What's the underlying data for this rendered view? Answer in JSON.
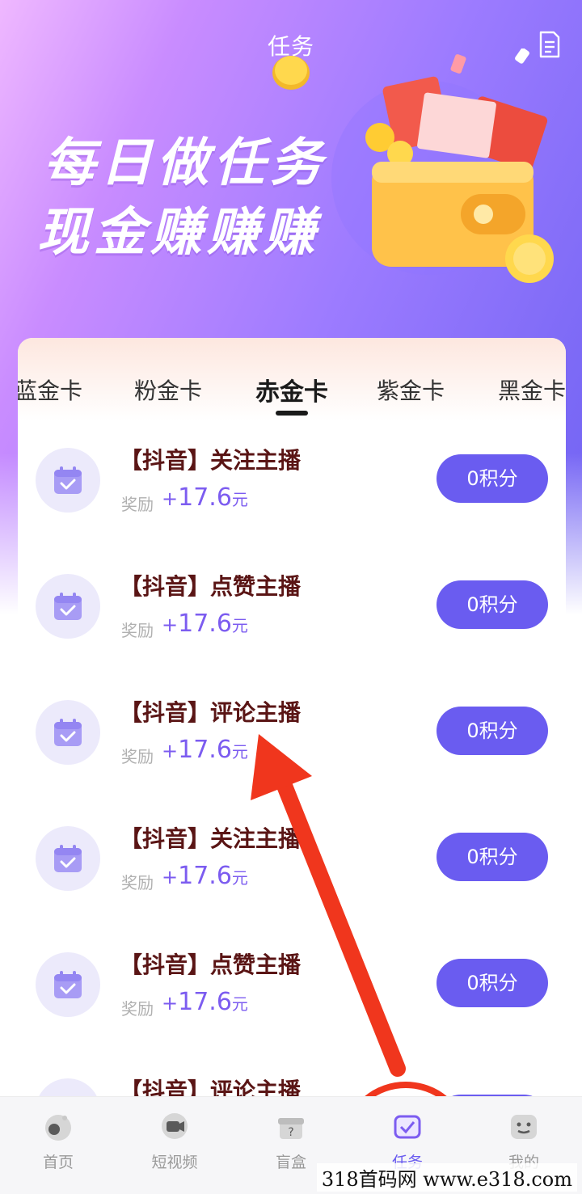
{
  "header": {
    "title": "任务",
    "banner_line1": "每日做任务",
    "banner_line2": "现金赚赚赚"
  },
  "tabs": [
    {
      "label": "蓝金卡",
      "active": false
    },
    {
      "label": "粉金卡",
      "active": false
    },
    {
      "label": "赤金卡",
      "active": true
    },
    {
      "label": "紫金卡",
      "active": false
    },
    {
      "label": "黑金卡",
      "active": false
    }
  ],
  "tasks": [
    {
      "title": "【抖音】关注主播",
      "reward_label": "奖励",
      "reward_plus": "+",
      "reward_value": "17.6",
      "reward_unit": "元",
      "button": "0积分"
    },
    {
      "title": "【抖音】点赞主播",
      "reward_label": "奖励",
      "reward_plus": "+",
      "reward_value": "17.6",
      "reward_unit": "元",
      "button": "0积分"
    },
    {
      "title": "【抖音】评论主播",
      "reward_label": "奖励",
      "reward_plus": "+",
      "reward_value": "17.6",
      "reward_unit": "元",
      "button": "0积分"
    },
    {
      "title": "【抖音】关注主播",
      "reward_label": "奖励",
      "reward_plus": "+",
      "reward_value": "17.6",
      "reward_unit": "元",
      "button": "0积分"
    },
    {
      "title": "【抖音】点赞主播",
      "reward_label": "奖励",
      "reward_plus": "+",
      "reward_value": "17.6",
      "reward_unit": "元",
      "button": "0积分"
    },
    {
      "title": "【抖音】评论主播"
    }
  ],
  "nav": [
    {
      "label": "首页",
      "icon": "home-icon",
      "active": false
    },
    {
      "label": "短视频",
      "icon": "video-icon",
      "active": false
    },
    {
      "label": "盲盒",
      "icon": "blind-box-icon",
      "active": false
    },
    {
      "label": "任务",
      "icon": "task-icon",
      "active": true
    },
    {
      "label": "我的",
      "icon": "profile-icon",
      "active": false
    }
  ],
  "watermark": "318首码网  www.e318.com",
  "colors": {
    "accent": "#6a5cf0",
    "task_title": "#5a1515",
    "reward_value": "#7c5cf0",
    "annotation": "#f0361d"
  }
}
